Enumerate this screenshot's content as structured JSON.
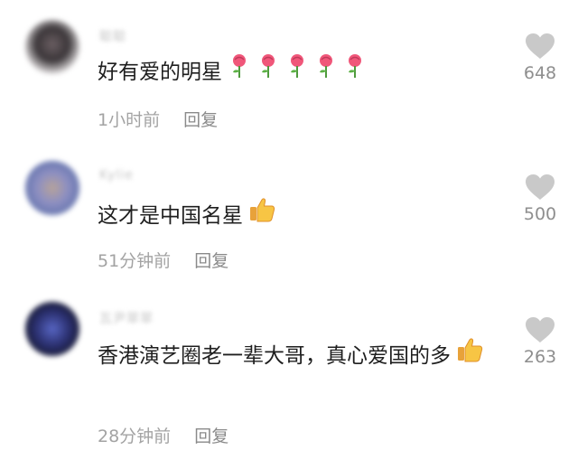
{
  "comments": [
    {
      "username": "聪聪",
      "text": "好有爱的明星",
      "emojis": [
        "rose-icon",
        "rose-icon",
        "rose-icon",
        "rose-icon",
        "rose-icon"
      ],
      "time": "1小时前",
      "reply_label": "回复",
      "likes": "648",
      "avatar_color": "#3a3538"
    },
    {
      "username": "Kylie",
      "text": "这才是中国名星",
      "emojis": [
        "thumbs-up-icon"
      ],
      "time": "51分钟前",
      "reply_label": "回复",
      "likes": "500",
      "avatar_color": "#7d86b8"
    },
    {
      "username": "瓦尹翠翠",
      "text": "香港演艺圈老一辈大哥，真心爱国的多",
      "emojis": [
        "thumbs-up-icon"
      ],
      "time": "28分钟前",
      "reply_label": "回复",
      "likes": "263",
      "avatar_color": "#2a2f6e"
    }
  ],
  "colors": {
    "text": "#1f1f1f",
    "meta": "#a3a3a3",
    "heart": "#c9c9c9"
  }
}
